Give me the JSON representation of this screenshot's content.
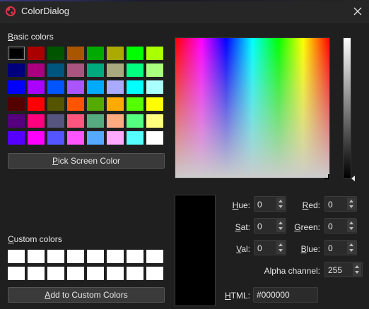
{
  "window": {
    "title": "ColorDialog",
    "close_glyph": "✕",
    "icon": "app-logo-icon"
  },
  "basic_colors": {
    "label_accel": "B",
    "label_rest": "asic colors",
    "swatches": [
      "#000000",
      "#aa0000",
      "#005500",
      "#aa5500",
      "#00aa00",
      "#aaaa00",
      "#00ff00",
      "#aaff00",
      "#00007f",
      "#aa007f",
      "#00557f",
      "#aa557f",
      "#00aa7f",
      "#aaaa7f",
      "#00ff7f",
      "#aaff7f",
      "#0000ff",
      "#aa00ff",
      "#0055ff",
      "#aa55ff",
      "#00aaff",
      "#aaaaff",
      "#00ffff",
      "#aaffff",
      "#550000",
      "#ff0000",
      "#555500",
      "#ff5500",
      "#55aa00",
      "#ffaa00",
      "#55ff00",
      "#ffff00",
      "#55007f",
      "#ff007f",
      "#55557f",
      "#ff557f",
      "#55aa7f",
      "#ffaa7f",
      "#55ff7f",
      "#ffff7f",
      "#5500ff",
      "#ff00ff",
      "#5555ff",
      "#ff55ff",
      "#55aaff",
      "#ffaaff",
      "#55ffff",
      "#ffffff"
    ],
    "selected_index": 0
  },
  "pick_screen_button": {
    "accel": "P",
    "rest": "ick Screen Color"
  },
  "custom_colors": {
    "label_accel": "C",
    "label_rest": "ustom colors",
    "swatches": [
      "#ffffff",
      "#ffffff",
      "#ffffff",
      "#ffffff",
      "#ffffff",
      "#ffffff",
      "#ffffff",
      "#ffffff",
      "#ffffff",
      "#ffffff",
      "#ffffff",
      "#ffffff",
      "#ffffff",
      "#ffffff",
      "#ffffff",
      "#ffffff"
    ]
  },
  "add_custom_button": {
    "accel": "A",
    "rest": "dd to Custom Colors"
  },
  "current_color": "#000000",
  "fields": {
    "hue": {
      "accel": "H",
      "rest": "ue:",
      "value": "0"
    },
    "sat": {
      "accel": "S",
      "rest": "at:",
      "value": "0"
    },
    "val": {
      "accel": "V",
      "rest": "al:",
      "value": "0"
    },
    "red": {
      "accel": "R",
      "rest": "ed:",
      "value": "0"
    },
    "green": {
      "accel": "G",
      "rest": "reen:",
      "value": "0"
    },
    "blue": {
      "accel": "B",
      "rest": "lue:",
      "value": "0"
    },
    "alpha": {
      "label": "Alpha channel:",
      "value": "255"
    },
    "html": {
      "accel": "H",
      "rest": "TML:",
      "value": "#000000"
    }
  }
}
